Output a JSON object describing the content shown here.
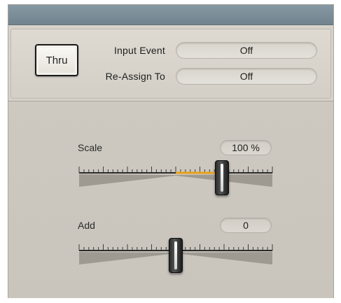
{
  "thru_button": {
    "label": "Thru"
  },
  "input_event": {
    "label": "Input Event",
    "value": "Off"
  },
  "reassign": {
    "label": "Re-Assign To",
    "value": "Off"
  },
  "scale": {
    "label": "Scale",
    "value": "100 %",
    "position": 0.74,
    "highlight_from": 0.5
  },
  "add": {
    "label": "Add",
    "value": "0",
    "position": 0.5
  },
  "colors": {
    "accent": "#e8a21a",
    "panel": "#d6d2ca",
    "titlebar": "#7b8d97"
  }
}
